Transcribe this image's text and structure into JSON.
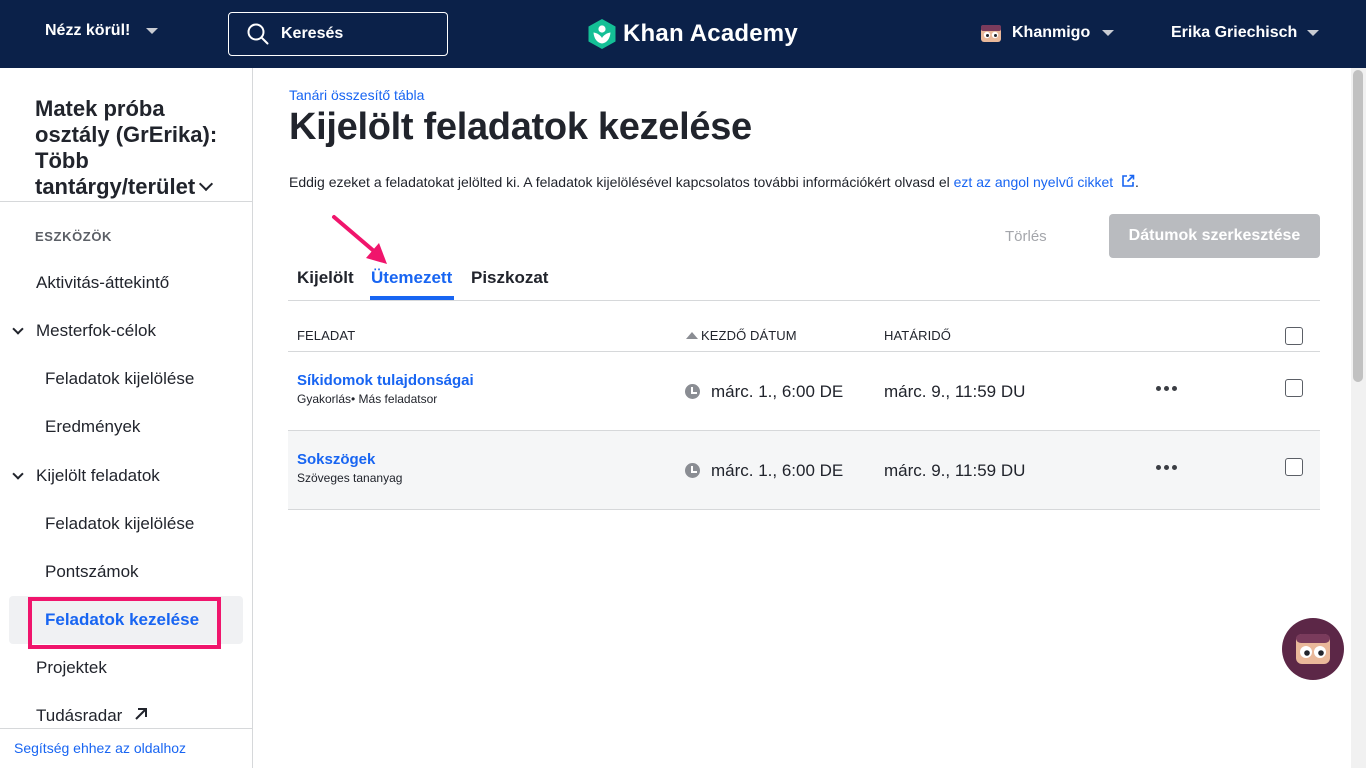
{
  "topnav": {
    "explore": "Nézz körül!",
    "search_placeholder": "Keresés",
    "brand": "Khan Academy",
    "khanmigo": "Khanmigo",
    "user": "Erika Griechisch"
  },
  "sidebar": {
    "class_title": "Matek próba osztály (GrErika): Több tantárgy/terület",
    "tools_header": "ESZKÖZÖK",
    "items": [
      {
        "label": "Aktivitás-áttekintő"
      },
      {
        "label": "Mesterfok-célok"
      },
      {
        "label": "Feladatok kijelölése"
      },
      {
        "label": "Eredmények"
      },
      {
        "label": "Kijelölt feladatok"
      },
      {
        "label": "Feladatok kijelölése"
      },
      {
        "label": "Pontszámok"
      },
      {
        "label": "Feladatok kezelése"
      },
      {
        "label": "Projektek"
      },
      {
        "label": "Tudásradar"
      }
    ],
    "help_link": "Segítség ehhez az oldalhoz"
  },
  "main": {
    "breadcrumb": "Tanári összesítő tábla",
    "title": "Kijelölt feladatok kezelése",
    "intro_text": "Eddig ezeket a feladatokat jelölted ki. A feladatok kijelölésével kapcsolatos további információkért olvasd el ",
    "intro_link": "ezt az angol nyelvű cikket",
    "intro_end": ".",
    "delete_button": "Törlés",
    "edit_dates_button": "Dátumok szerkesztése",
    "tabs": [
      {
        "label": "Kijelölt"
      },
      {
        "label": "Ütemezett"
      },
      {
        "label": "Piszkozat"
      }
    ],
    "active_tab": "Ütemezett",
    "table": {
      "headers": [
        "FELADAT",
        "KEZDŐ DÁTUM",
        "HATÁRIDŐ"
      ],
      "rows": [
        {
          "title": "Síkidomok tulajdonságai",
          "subtitle": "Gyakorlás• Más feladatsor",
          "start": "márc. 1., 6:00 DE",
          "due": "márc. 9., 11:59 DU"
        },
        {
          "title": "Sokszögek",
          "subtitle": "Szöveges tananyag",
          "start": "márc. 1., 6:00 DE",
          "due": "márc. 9., 11:59 DU"
        }
      ]
    }
  },
  "colors": {
    "nav_bg": "#0b2149",
    "link": "#1865f2",
    "highlight": "#f0156c",
    "logo_green": "#14bf96"
  }
}
